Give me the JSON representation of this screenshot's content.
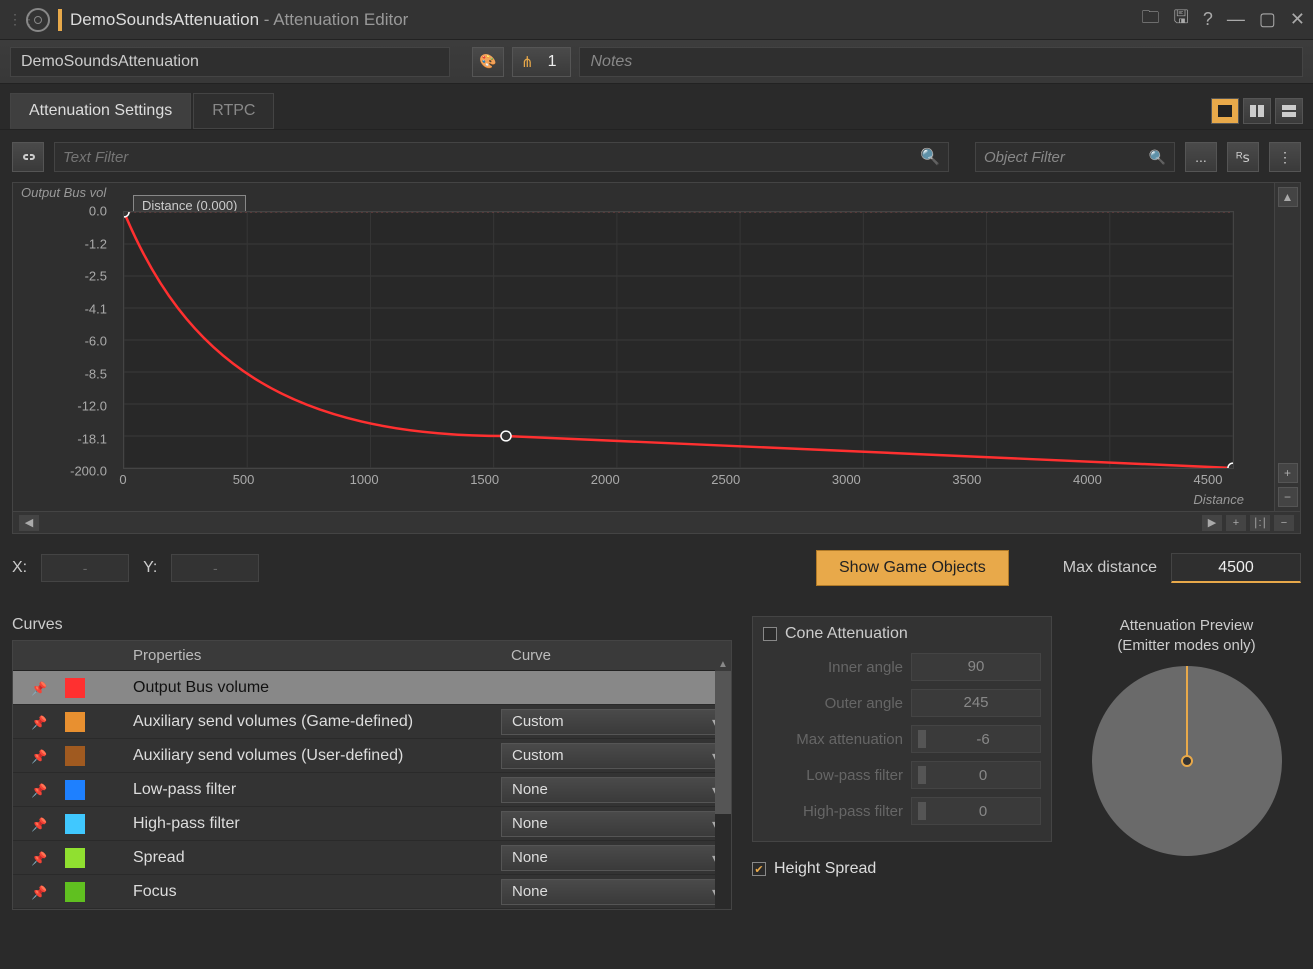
{
  "window": {
    "title_main": "DemoSoundsAttenuation",
    "title_suffix": " - Attenuation Editor"
  },
  "header": {
    "object_name": "DemoSoundsAttenuation",
    "share_count": "1",
    "notes_placeholder": "Notes"
  },
  "tabs": {
    "settings": "Attenuation Settings",
    "rtpc": "RTPC"
  },
  "filters": {
    "text_placeholder": "Text Filter",
    "object_placeholder": "Object Filter",
    "browse_label": "...",
    "rs_label": "ᴿꜱ"
  },
  "chart": {
    "y_title": "Output Bus vol",
    "x_title": "Distance",
    "tooltip": "Distance (0.000)"
  },
  "chart_data": {
    "type": "line",
    "title": "Output Bus volume vs Distance",
    "xlabel": "Distance",
    "ylabel": "Output Bus volume",
    "x_ticks": [
      0,
      500,
      1000,
      1500,
      2000,
      2500,
      3000,
      3500,
      4000,
      4500
    ],
    "y_ticks": [
      0.0,
      -1.2,
      -2.5,
      -4.1,
      -6.0,
      -8.5,
      -12.0,
      -18.1,
      -200.0
    ],
    "xlim": [
      0,
      4500
    ],
    "ylim_visual": [
      -200.0,
      0.0
    ],
    "control_points": [
      {
        "x": 0,
        "y": 0.0
      },
      {
        "x": 1550,
        "y": -18.1
      },
      {
        "x": 4500,
        "y": -200.0
      }
    ]
  },
  "coords": {
    "x_label": "X:",
    "y_label": "Y:",
    "x_val": "-",
    "y_val": "-"
  },
  "buttons": {
    "show_game_objects": "Show Game Objects"
  },
  "max_distance": {
    "label": "Max distance",
    "value": "4500"
  },
  "curves": {
    "title": "Curves",
    "col_properties": "Properties",
    "col_curve": "Curve",
    "rows": [
      {
        "color": "#ff3030",
        "property": "Output Bus volume",
        "curve": "",
        "selected": true
      },
      {
        "color": "#e89030",
        "property": "Auxiliary send volumes (Game-defined)",
        "curve": "Custom"
      },
      {
        "color": "#a05a20",
        "property": "Auxiliary send volumes (User-defined)",
        "curve": "Custom"
      },
      {
        "color": "#1e80ff",
        "property": "Low-pass filter",
        "curve": "None"
      },
      {
        "color": "#40c8ff",
        "property": "High-pass filter",
        "curve": "None"
      },
      {
        "color": "#90e030",
        "property": "Spread",
        "curve": "None"
      },
      {
        "color": "#60c020",
        "property": "Focus",
        "curve": "None"
      }
    ]
  },
  "cone": {
    "title": "Cone Attenuation",
    "inner_angle_label": "Inner angle",
    "inner_angle_val": "90",
    "outer_angle_label": "Outer angle",
    "outer_angle_val": "245",
    "max_att_label": "Max attenuation",
    "max_att_val": "-6",
    "lpf_label": "Low-pass filter",
    "lpf_val": "0",
    "hpf_label": "High-pass filter",
    "hpf_val": "0"
  },
  "height_spread": {
    "label": "Height Spread"
  },
  "preview": {
    "title_line1": "Attenuation Preview",
    "title_line2": "(Emitter modes only)"
  }
}
